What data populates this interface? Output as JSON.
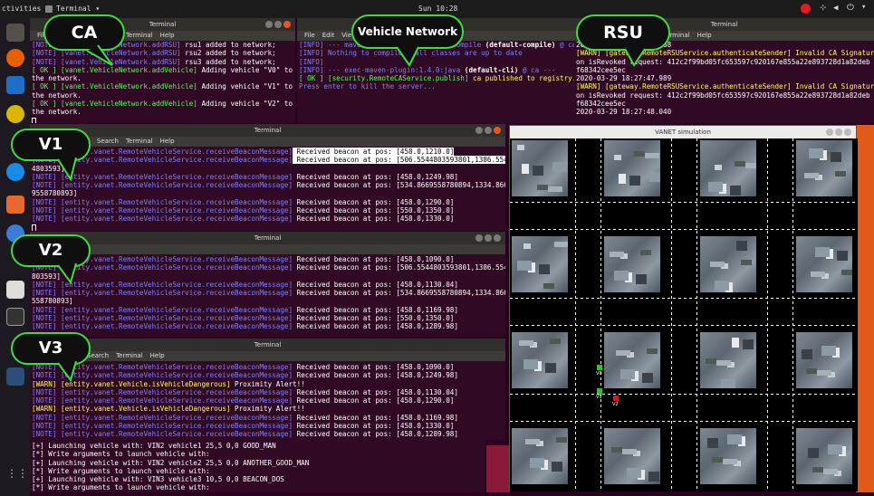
{
  "topbar": {
    "activities": "ctivities",
    "app": "Terminal ▾",
    "clock": "Sun 10:28"
  },
  "callouts": {
    "ca": "CA",
    "network": "Vehicle Network",
    "rsu": "RSU",
    "v1": "V1",
    "v2": "V2",
    "v3": "V3"
  },
  "win_ca": {
    "title": "Terminal",
    "menu": [
      "File",
      "Edit",
      "View",
      "Search",
      "Terminal",
      "Help"
    ],
    "lines": [
      {
        "a": "[NOTE] [vanet.VehicleNetwork.addRSU]",
        "b": " rsu1 added to network;"
      },
      {
        "a": "[NOTE] [vanet.VehicleNetwork.addRSU]",
        "b": " rsu2 added to network;"
      },
      {
        "a": "[NOTE] [vanet.VehicleNetwork.addRSU]",
        "b": " rsu3 added to network;"
      },
      {
        "a": "[ OK ] [vanet.VehicleNetwork.addVehicle]",
        "b": " Adding vehicle \"V0\" to"
      },
      {
        "a": "",
        "b": "the network."
      },
      {
        "a": "[ OK ] [vanet.VehicleNetwork.addVehicle]",
        "b": " Adding vehicle \"V1\" to"
      },
      {
        "a": "",
        "b": "the network."
      },
      {
        "a": "[ OK ] [vanet.VehicleNetwork.addVehicle]",
        "b": " Adding vehicle \"V2\" to"
      },
      {
        "a": "",
        "b": "the network."
      }
    ]
  },
  "win_net": {
    "title": "Terminal",
    "menu": [
      "File",
      "Edit",
      "View"
    ],
    "lines": [
      {
        "a": "[INFO] --- maven-compiler-plugin:3.1:compile ",
        "b": "(default-compile)",
        "c": " @ ca ---"
      },
      {
        "a": "[INFO] Nothing to compile - all classes are up to date",
        "b": "",
        "c": ""
      },
      {
        "a": "[INFO]",
        "b": "",
        "c": ""
      },
      {
        "a": "[INFO] --- exec-maven-plugin:1.4.0:java ",
        "b": "(default-cli)",
        "c": " @ ca ---"
      },
      {
        "a": "[ OK ] [security.RemoteCAService.publish]",
        "b": "",
        "c": " ca published to registry."
      },
      {
        "a": "Press enter to kill the server...",
        "b": "",
        "c": ""
      }
    ]
  },
  "win_rsu": {
    "title": "Terminal",
    "menu": [
      "Terminal",
      "Help"
    ],
    "lines": [
      "2020-03-29 18:27:47.768",
      "[WARN] [gateway.RemoteRSUService.authenticateSender] Invalid CA Signature",
      "on isRevoked request: 412c2f99bd05fc653597c920167e855a22e893728d1a82deb",
      "f68342cee5ec",
      "2020-03-29 18:27:47.989",
      "[WARN] [gateway.RemoteRSUService.authenticateSender] Invalid CA Signature",
      "on isRevoked request: 412c2f99bd05fc653597c920167e855a22e893728d1a82deb",
      "f68342cee5ec",
      "2020-03-29 18:27:48.040"
    ]
  },
  "win_v1": {
    "title": "Terminal",
    "menu": [
      "File",
      "Edit",
      "View",
      "Search",
      "Terminal",
      "Help"
    ],
    "lines": [
      {
        "tag": "[NOTE]",
        "src": "[entity.vanet.RemoteVehicleService.receiveBeaconMessage]",
        "msg": " Received beacon at pos: [458.0,1210.0]"
      },
      {
        "tag": "[NOTE]",
        "src": "[entity.vanet.RemoteVehicleService.receiveBeaconMessage]",
        "msg": " Received beacon at pos: [506.5544803593801,1386.554"
      },
      {
        "tag": "",
        "src": "",
        "msg": "4803593]"
      },
      {
        "tag": "[NOTE]",
        "src": "[entity.vanet.RemoteVehicleService.receiveBeaconMessage]",
        "msg": " Received beacon at pos: [458.0,1249.98]"
      },
      {
        "tag": "[NOTE]",
        "src": "[entity.vanet.RemoteVehicleService.receiveBeaconMessage]",
        "msg": " Received beacon at pos: [534.8669558780894,1334.866"
      },
      {
        "tag": "",
        "src": "",
        "msg": "9558780893]"
      },
      {
        "tag": "[NOTE]",
        "src": "[entity.vanet.RemoteVehicleService.receiveBeaconMessage]",
        "msg": " Received beacon at pos: [458.0,1290.0]"
      },
      {
        "tag": "[NOTE]",
        "src": "[entity.vanet.RemoteVehicleService.receiveBeaconMessage]",
        "msg": " Received beacon at pos: [550.0,1350.0]"
      },
      {
        "tag": "[NOTE]",
        "src": "[entity.vanet.RemoteVehicleService.receiveBeaconMessage]",
        "msg": " Received beacon at pos: [458.0,1330.0]"
      }
    ]
  },
  "win_v2": {
    "title": "Terminal",
    "lines": [
      {
        "tag": "[NOTE]",
        "src": "[entity.vanet.RemoteVehicleService.receiveBeaconMessage]",
        "msg": " Received beacon at pos: [458.0,1090.0]"
      },
      {
        "tag": "[NOTE]",
        "src": "[entity.vanet.RemoteVehicleService.receiveBeaconMessage]",
        "msg": " Received beacon at pos: [506.5544803593801,1386.5544"
      },
      {
        "tag": "",
        "src": "",
        "msg": "803593]"
      },
      {
        "tag": "[NOTE]",
        "src": "[entity.vanet.RemoteVehicleService.receiveBeaconMessage]",
        "msg": " Received beacon at pos: [458.0,1130.04]"
      },
      {
        "tag": "[NOTE]",
        "src": "[entity.vanet.RemoteVehicleService.receiveBeaconMessage]",
        "msg": " Received beacon at pos: [534.8669558780894,1334.8669"
      },
      {
        "tag": "",
        "src": "",
        "msg": "558780893]"
      },
      {
        "tag": "[NOTE]",
        "src": "[entity.vanet.RemoteVehicleService.receiveBeaconMessage]",
        "msg": " Received beacon at pos: [458.0,1169.98]"
      },
      {
        "tag": "[NOTE]",
        "src": "[entity.vanet.RemoteVehicleService.receiveBeaconMessage]",
        "msg": " Received beacon at pos: [550.0,1350.0]"
      },
      {
        "tag": "[NOTE]",
        "src": "[entity.vanet.RemoteVehicleService.receiveBeaconMessage]",
        "msg": " Received beacon at pos: [458.0,1289.98]"
      }
    ]
  },
  "win_v3": {
    "title": "Terminal",
    "menu": [
      "Search",
      "Terminal",
      "Help"
    ],
    "lines": [
      {
        "tag": "[NOTE]",
        "src": "[entity.vanet.RemoteVehicleService.receiveBeaconMessage]",
        "msg": " Received beacon at pos: [458.0,1090.0]",
        "warn": false
      },
      {
        "tag": "[NOTE]",
        "src": "[entity.vanet.RemoteVehicleService.receiveBeaconMessage]",
        "msg": " Received beacon at pos: [458.0,1249.98]",
        "warn": false
      },
      {
        "tag": "[WARN]",
        "src": "[entity.vanet.Vehicle.isVehicleDangerous]",
        "msg": " Proximity Alert!!",
        "warn": true
      },
      {
        "tag": "[NOTE]",
        "src": "[entity.vanet.RemoteVehicleService.receiveBeaconMessage]",
        "msg": " Received beacon at pos: [458.0,1130.04]",
        "warn": false
      },
      {
        "tag": "[NOTE]",
        "src": "[entity.vanet.RemoteVehicleService.receiveBeaconMessage]",
        "msg": " Received beacon at pos: [458.0,1290.0]",
        "warn": false
      },
      {
        "tag": "[WARN]",
        "src": "[entity.vanet.Vehicle.isVehicleDangerous]",
        "msg": " Proximity Alert!!",
        "warn": true
      },
      {
        "tag": "[NOTE]",
        "src": "[entity.vanet.RemoteVehicleService.receiveBeaconMessage]",
        "msg": " Received beacon at pos: [458.0,1169.98]",
        "warn": false
      },
      {
        "tag": "[NOTE]",
        "src": "[entity.vanet.RemoteVehicleService.receiveBeaconMessage]",
        "msg": " Received beacon at pos: [458.0,1330.0]",
        "warn": false
      },
      {
        "tag": "[NOTE]",
        "src": "[entity.vanet.RemoteVehicleService.receiveBeaconMessage]",
        "msg": " Received beacon at pos: [458.0,1289.98]",
        "warn": false
      }
    ]
  },
  "bottom_console": {
    "lines": [
      "[+] Launching vehicle with: VIN2 vehicle1 25,5 0,0 GOOD_MAN",
      "[*] Write arguments to launch vehicle with:",
      "[+] Launching vehicle with: VIN2 vehicle2 25,5 0,0 ANOTHER_GOOD_MAN",
      "[*] Write arguments to launch vehicle with:",
      "[+] Launching vehicle with: VIN3 vehicle3 10,5 0,0 BEACON_DOS",
      "[*] Write arguments to launch vehicle with: "
    ]
  },
  "sim": {
    "title": "VANET simulation",
    "vehicles": [
      {
        "label": "V0",
        "color": "#22cc22"
      },
      {
        "label": "V1",
        "color": "#22cc22"
      },
      {
        "label": "V2",
        "color": "#e01515"
      }
    ]
  },
  "colors": {
    "accent": "#3fdc3f",
    "terminal_bg": "#300a24",
    "note": "#7f7fff",
    "ok": "#55ff55",
    "warn": "#ffff55"
  }
}
